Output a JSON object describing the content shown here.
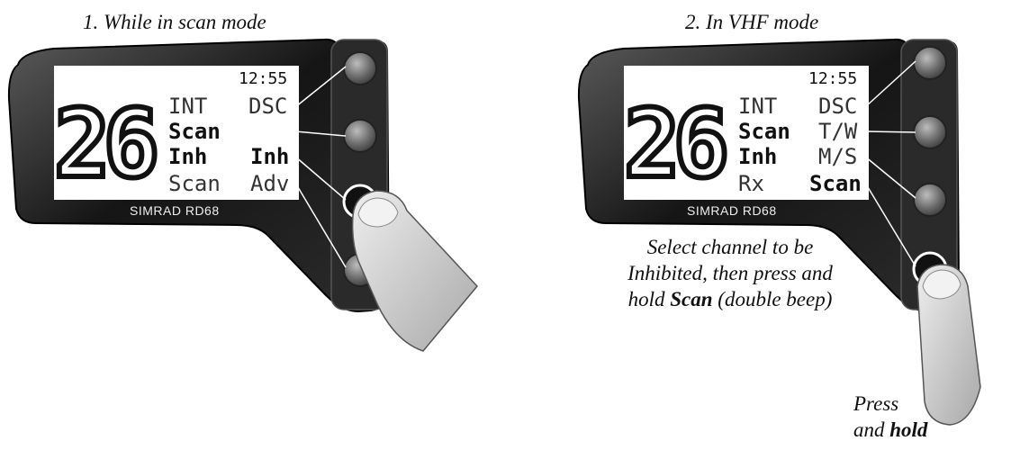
{
  "panels": [
    {
      "caption": "1. While in scan mode",
      "display": {
        "time": "12:55",
        "channel": "26",
        "left": [
          "INT",
          "Scan",
          "Inh",
          "Scan"
        ],
        "right": [
          "DSC",
          "",
          "Inh",
          "Adv"
        ]
      },
      "brand": "SIMRAD RD68"
    },
    {
      "caption": "2. In VHF mode",
      "display": {
        "time": "12:55",
        "channel": "26",
        "left": [
          "INT",
          "Scan",
          "Inh",
          "Rx"
        ],
        "right": [
          "DSC",
          "T/W",
          "M/S",
          "Scan"
        ]
      },
      "brand": "SIMRAD RD68",
      "instruction": {
        "line1": "Select channel to be",
        "line2": "Inhibited, then press and",
        "line3_pre": "hold ",
        "line3_bold": "Scan",
        "line3_post": " (double beep)"
      },
      "press": {
        "line1": "Press",
        "line2_pre": "and ",
        "line2_bold": "hold"
      }
    }
  ],
  "colors": {
    "bezel": "#1a1a1a",
    "screen": "#ffffff",
    "finger": "#d9d9d9"
  }
}
